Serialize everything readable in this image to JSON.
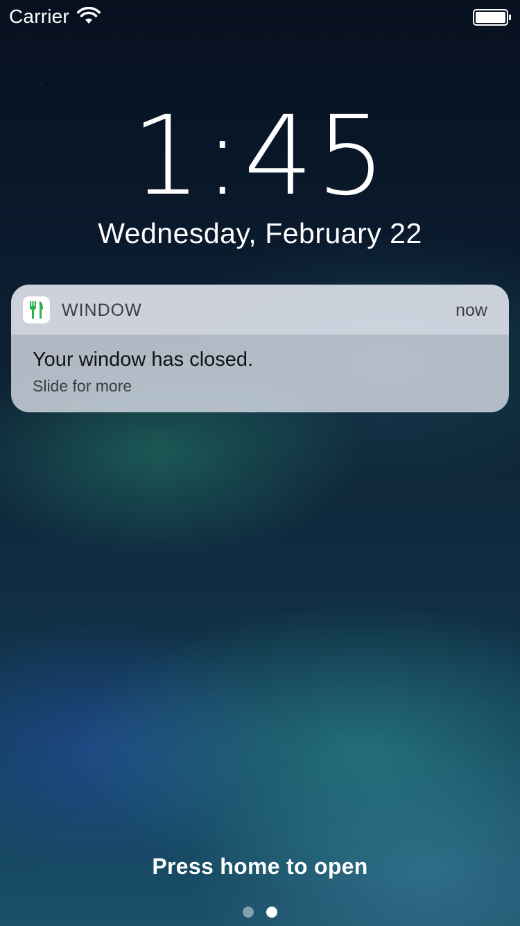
{
  "status_bar": {
    "carrier": "Carrier",
    "wifi_icon": "wifi-icon",
    "battery_icon": "battery-icon"
  },
  "lock_screen": {
    "time": "1:45",
    "date": "Wednesday, February 22"
  },
  "notification": {
    "app_icon": "fork-knife-icon",
    "app_icon_color": "#2fb24c",
    "app_name": "WINDOW",
    "time": "now",
    "title": "Your window has closed.",
    "subtitle": "Slide for more"
  },
  "footer": {
    "hint": "Press home to open",
    "pages": 2,
    "current_page": 2
  }
}
